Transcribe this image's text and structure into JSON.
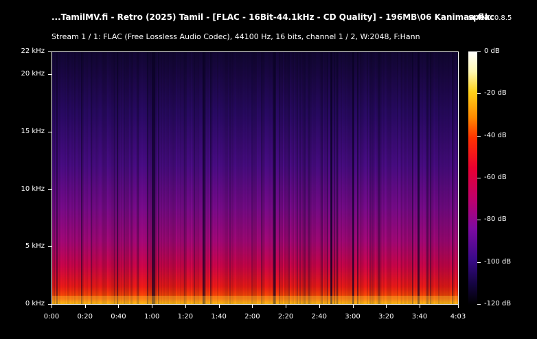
{
  "window": {
    "title": "...TamilMV.fi - Retro (2025) Tamil - [FLAC - 16Bit-44.1kHz - CD Quality] - 196MB\\06 Kanimaa.flac",
    "app_name": "spek",
    "app_version": "0.8.5"
  },
  "stream_info": "Stream 1 / 1: FLAC (Free Lossless Audio Codec), 44100 Hz, 16 bits, channel 1 / 2, W:2048, F:Hann",
  "frequency_axis": {
    "ticks": [
      "22 kHz",
      "20 kHz",
      "15 kHz",
      "10 kHz",
      "5 kHz",
      "0 kHz"
    ],
    "values_khz": [
      22,
      20,
      15,
      10,
      5,
      0
    ]
  },
  "time_axis": {
    "ticks": [
      "0:00",
      "0:20",
      "0:40",
      "1:00",
      "1:20",
      "1:40",
      "2:00",
      "2:20",
      "2:40",
      "3:00",
      "3:20",
      "3:40",
      "4:03"
    ],
    "values_s": [
      0,
      20,
      40,
      60,
      80,
      100,
      120,
      140,
      160,
      180,
      200,
      220,
      243
    ]
  },
  "color_scale": {
    "ticks": [
      "0 dB",
      "-20 dB",
      "-40 dB",
      "-60 dB",
      "-80 dB",
      "-100 dB",
      "-120 dB"
    ],
    "values_db": [
      0,
      -20,
      -40,
      -60,
      -80,
      -100,
      -120
    ]
  },
  "colors": {
    "background": "#000000",
    "foreground": "#ffffff"
  }
}
